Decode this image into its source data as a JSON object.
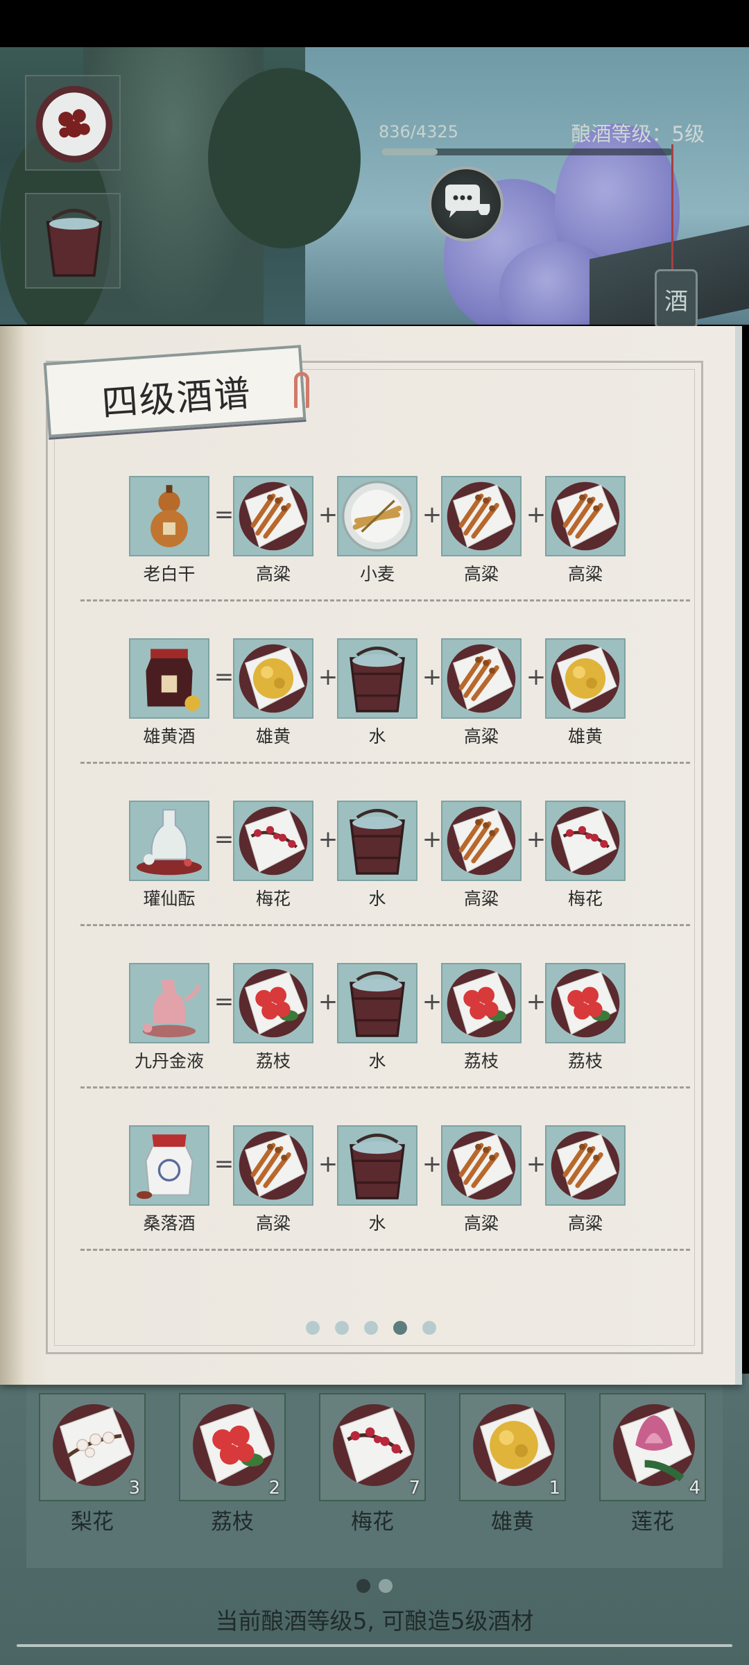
{
  "status": {
    "progress_text": "836/4325",
    "progress_value": 836,
    "progress_max": 4325,
    "brew_level_text": "酿酒等级：5级",
    "sign_text": "酒"
  },
  "side_items": [
    {
      "name": "dried-flowers-icon"
    },
    {
      "name": "water-bucket-icon"
    }
  ],
  "book": {
    "title": "四级酒谱",
    "operators": {
      "equals": "=",
      "plus": "+"
    },
    "recipes": [
      {
        "product": "老白干",
        "product_icon": "gourd-icon",
        "ingredients": [
          "高粱",
          "小麦",
          "高粱",
          "高粱"
        ],
        "ingredient_icons": [
          "sorghum-icon",
          "wheat-icon",
          "sorghum-icon",
          "sorghum-icon"
        ]
      },
      {
        "product": "雄黄酒",
        "product_icon": "wine-jar-icon",
        "ingredients": [
          "雄黄",
          "水",
          "高粱",
          "雄黄"
        ],
        "ingredient_icons": [
          "realgar-icon",
          "water-bucket-icon",
          "sorghum-icon",
          "realgar-icon"
        ]
      },
      {
        "product": "瓘仙酝",
        "product_icon": "porcelain-bottle-icon",
        "ingredients": [
          "梅花",
          "水",
          "高粱",
          "梅花"
        ],
        "ingredient_icons": [
          "plum-blossom-icon",
          "water-bucket-icon",
          "sorghum-icon",
          "plum-blossom-icon"
        ]
      },
      {
        "product": "九丹金液",
        "product_icon": "pink-ewer-icon",
        "ingredients": [
          "荔枝",
          "水",
          "荔枝",
          "荔枝"
        ],
        "ingredient_icons": [
          "lychee-icon",
          "water-bucket-icon",
          "lychee-icon",
          "lychee-icon"
        ]
      },
      {
        "product": "桑落酒",
        "product_icon": "white-wine-jar-icon",
        "ingredients": [
          "高粱",
          "水",
          "高粱",
          "高粱"
        ],
        "ingredient_icons": [
          "sorghum-icon",
          "water-bucket-icon",
          "sorghum-icon",
          "sorghum-icon"
        ]
      }
    ],
    "pager": {
      "count": 5,
      "active": 3
    }
  },
  "inventory": {
    "items": [
      {
        "name": "梨花",
        "count": "3",
        "icon": "pear-blossom-icon"
      },
      {
        "name": "荔枝",
        "count": "2",
        "icon": "lychee-icon"
      },
      {
        "name": "梅花",
        "count": "7",
        "icon": "plum-blossom-icon"
      },
      {
        "name": "雄黄",
        "count": "1",
        "icon": "realgar-icon"
      },
      {
        "name": "莲花",
        "count": "4",
        "icon": "lotus-icon"
      }
    ],
    "pager": {
      "count": 2,
      "active": 0
    },
    "note": "当前酿酒等级5, 可酿造5级酒材"
  },
  "colors": {
    "cell_bg": "#9ebfbf",
    "plate_rim": "#5a2a2e",
    "sorghum": "#b8682c",
    "realgar": "#e0b43a",
    "lychee": "#d8393a",
    "plum": "#b8283a",
    "water": "#a7c6cc"
  }
}
